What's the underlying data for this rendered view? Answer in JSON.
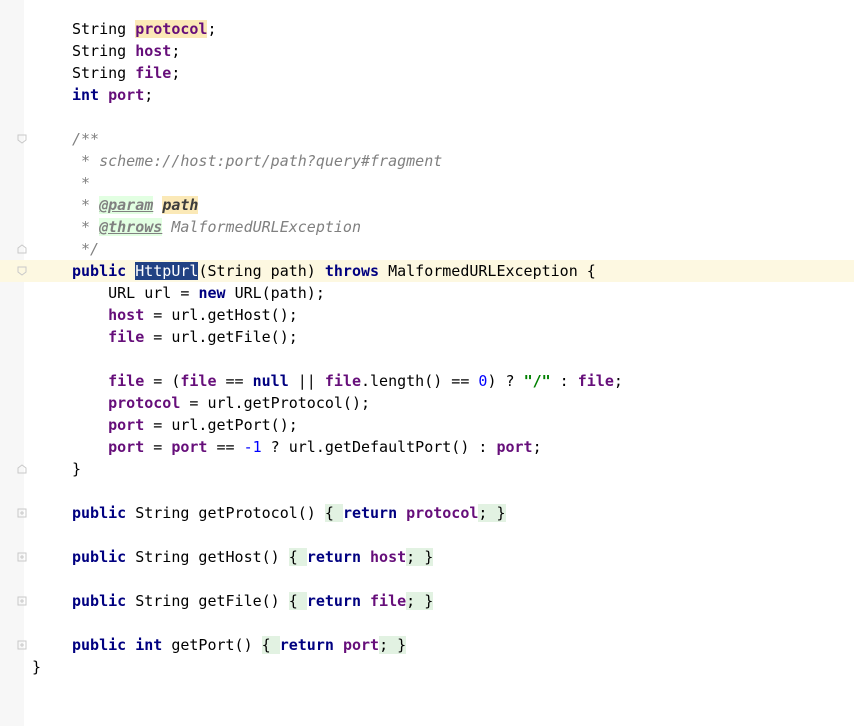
{
  "editor": {
    "lines": [
      {
        "id": "l1",
        "parts": [
          {
            "t": "String ",
            "c": "plain"
          },
          {
            "t": "protocol",
            "c": "fldbg"
          },
          {
            "t": ";",
            "c": "plain"
          }
        ]
      },
      {
        "id": "l2",
        "parts": [
          {
            "t": "String ",
            "c": "plain"
          },
          {
            "t": "host",
            "c": "fld"
          },
          {
            "t": ";",
            "c": "plain"
          }
        ]
      },
      {
        "id": "l3",
        "parts": [
          {
            "t": "String ",
            "c": "plain"
          },
          {
            "t": "file",
            "c": "fld"
          },
          {
            "t": ";",
            "c": "plain"
          }
        ]
      },
      {
        "id": "l4",
        "parts": [
          {
            "t": "int ",
            "c": "kw"
          },
          {
            "t": "port",
            "c": "fld"
          },
          {
            "t": ";",
            "c": "plain"
          }
        ]
      },
      {
        "id": "l5",
        "parts": []
      },
      {
        "id": "l6",
        "fold": "open",
        "parts": [
          {
            "t": "/**",
            "c": "cmt"
          }
        ]
      },
      {
        "id": "l7",
        "parts": [
          {
            "t": " * scheme://host:port/path?query#fragment",
            "c": "cmt"
          }
        ]
      },
      {
        "id": "l8",
        "parts": [
          {
            "t": " *",
            "c": "cmt"
          }
        ]
      },
      {
        "id": "l9",
        "parts": [
          {
            "t": " * ",
            "c": "cmt"
          },
          {
            "t": "@param",
            "c": "tag"
          },
          {
            "t": " ",
            "c": "cmt"
          },
          {
            "t": "path",
            "c": "tagname"
          }
        ]
      },
      {
        "id": "l10",
        "parts": [
          {
            "t": " * ",
            "c": "cmt"
          },
          {
            "t": "@throws",
            "c": "tag"
          },
          {
            "t": " MalformedURLException",
            "c": "cmt"
          }
        ]
      },
      {
        "id": "l11",
        "fold": "close",
        "parts": [
          {
            "t": " */",
            "c": "cmt"
          }
        ]
      },
      {
        "id": "l12",
        "fold": "open",
        "hl": true,
        "parts": [
          {
            "t": "public ",
            "c": "kw"
          },
          {
            "t": "HttpUrl",
            "c": "sel"
          },
          {
            "t": "(String path) ",
            "c": "plain"
          },
          {
            "t": "throws ",
            "c": "kw"
          },
          {
            "t": "MalformedURLException {",
            "c": "plain"
          }
        ]
      },
      {
        "id": "l13",
        "parts": [
          {
            "t": "    URL url = ",
            "c": "plain"
          },
          {
            "t": "new ",
            "c": "kw"
          },
          {
            "t": "URL(path);",
            "c": "plain"
          }
        ]
      },
      {
        "id": "l14",
        "parts": [
          {
            "t": "    ",
            "c": "plain"
          },
          {
            "t": "host",
            "c": "fld"
          },
          {
            "t": " = url.getHost();",
            "c": "plain"
          }
        ]
      },
      {
        "id": "l15",
        "parts": [
          {
            "t": "    ",
            "c": "plain"
          },
          {
            "t": "file",
            "c": "fld"
          },
          {
            "t": " = url.getFile();",
            "c": "plain"
          }
        ]
      },
      {
        "id": "l16",
        "parts": []
      },
      {
        "id": "l17",
        "parts": [
          {
            "t": "    ",
            "c": "plain"
          },
          {
            "t": "file",
            "c": "fld"
          },
          {
            "t": " = (",
            "c": "plain"
          },
          {
            "t": "file",
            "c": "fld"
          },
          {
            "t": " == ",
            "c": "plain"
          },
          {
            "t": "null",
            "c": "kw"
          },
          {
            "t": " || ",
            "c": "plain"
          },
          {
            "t": "file",
            "c": "fld"
          },
          {
            "t": ".length() == ",
            "c": "plain"
          },
          {
            "t": "0",
            "c": "num"
          },
          {
            "t": ") ? ",
            "c": "plain"
          },
          {
            "t": "\"/\"",
            "c": "str"
          },
          {
            "t": " : ",
            "c": "plain"
          },
          {
            "t": "file",
            "c": "fld"
          },
          {
            "t": ";",
            "c": "plain"
          }
        ]
      },
      {
        "id": "l18",
        "parts": [
          {
            "t": "    ",
            "c": "plain"
          },
          {
            "t": "protocol",
            "c": "fld"
          },
          {
            "t": " = url.getProtocol();",
            "c": "plain"
          }
        ]
      },
      {
        "id": "l19",
        "parts": [
          {
            "t": "    ",
            "c": "plain"
          },
          {
            "t": "port",
            "c": "fld"
          },
          {
            "t": " = url.getPort();",
            "c": "plain"
          }
        ]
      },
      {
        "id": "l20",
        "parts": [
          {
            "t": "    ",
            "c": "plain"
          },
          {
            "t": "port",
            "c": "fld"
          },
          {
            "t": " = ",
            "c": "plain"
          },
          {
            "t": "port",
            "c": "fld"
          },
          {
            "t": " == ",
            "c": "plain"
          },
          {
            "t": "-1",
            "c": "num"
          },
          {
            "t": " ? url.getDefaultPort() : ",
            "c": "plain"
          },
          {
            "t": "port",
            "c": "fld"
          },
          {
            "t": ";",
            "c": "plain"
          }
        ]
      },
      {
        "id": "l21",
        "fold": "close",
        "parts": [
          {
            "t": "}",
            "c": "plain"
          }
        ]
      },
      {
        "id": "l22",
        "parts": []
      },
      {
        "id": "l23",
        "fold": "plus",
        "parts": [
          {
            "t": "public ",
            "c": "kw"
          },
          {
            "t": "String getProtocol() ",
            "c": "plain"
          },
          {
            "t": "{ ",
            "c": "fbr"
          },
          {
            "t": "return ",
            "c": "kw"
          },
          {
            "t": "protocol",
            "c": "fld"
          },
          {
            "t": "; }",
            "c": "fbr"
          }
        ]
      },
      {
        "id": "l24",
        "parts": []
      },
      {
        "id": "l25",
        "fold": "plus",
        "parts": [
          {
            "t": "public ",
            "c": "kw"
          },
          {
            "t": "String getHost() ",
            "c": "plain"
          },
          {
            "t": "{ ",
            "c": "fbr"
          },
          {
            "t": "return ",
            "c": "kw"
          },
          {
            "t": "host",
            "c": "fld"
          },
          {
            "t": "; }",
            "c": "fbr"
          }
        ]
      },
      {
        "id": "l26",
        "parts": []
      },
      {
        "id": "l27",
        "fold": "plus",
        "parts": [
          {
            "t": "public ",
            "c": "kw"
          },
          {
            "t": "String getFile() ",
            "c": "plain"
          },
          {
            "t": "{ ",
            "c": "fbr"
          },
          {
            "t": "return ",
            "c": "kw"
          },
          {
            "t": "file",
            "c": "fld"
          },
          {
            "t": "; }",
            "c": "fbr"
          }
        ]
      },
      {
        "id": "l28",
        "parts": []
      },
      {
        "id": "l29",
        "fold": "plus",
        "parts": [
          {
            "t": "public int ",
            "c": "kw"
          },
          {
            "t": "getPort() ",
            "c": "plain"
          },
          {
            "t": "{ ",
            "c": "fbr"
          },
          {
            "t": "return ",
            "c": "kw"
          },
          {
            "t": "port",
            "c": "fld"
          },
          {
            "t": "; }",
            "c": "fbr"
          }
        ]
      },
      {
        "id": "l30",
        "outer": true,
        "parts": [
          {
            "t": "}",
            "c": "plain"
          }
        ]
      }
    ],
    "colors": {
      "keyword": "#000080",
      "field": "#660e7a",
      "comment": "#808080",
      "string": "#008000",
      "number": "#0000ff",
      "selection": "#214283",
      "current_line": "#fdf8e1"
    }
  }
}
